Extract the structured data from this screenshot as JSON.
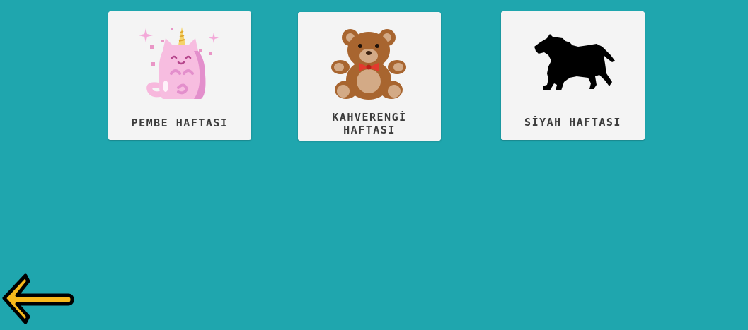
{
  "cards": [
    {
      "label": "PEMBE HAFTASI",
      "icon": "unicorn-cat-icon",
      "color": "#f6b3dc"
    },
    {
      "label_line1": "KAHVERENGİ",
      "label_line2": "HAFTASI",
      "icon": "teddy-bear-icon",
      "color": "#a9652f"
    },
    {
      "label": "SİYAH HAFTASI",
      "icon": "horse-silhouette-icon",
      "color": "#000000"
    }
  ],
  "nav": {
    "back_icon": "back-arrow-icon",
    "back_color": "#f7b91b"
  },
  "theme": {
    "background": "#1fa6ae",
    "card_background": "#f4f4f4"
  }
}
